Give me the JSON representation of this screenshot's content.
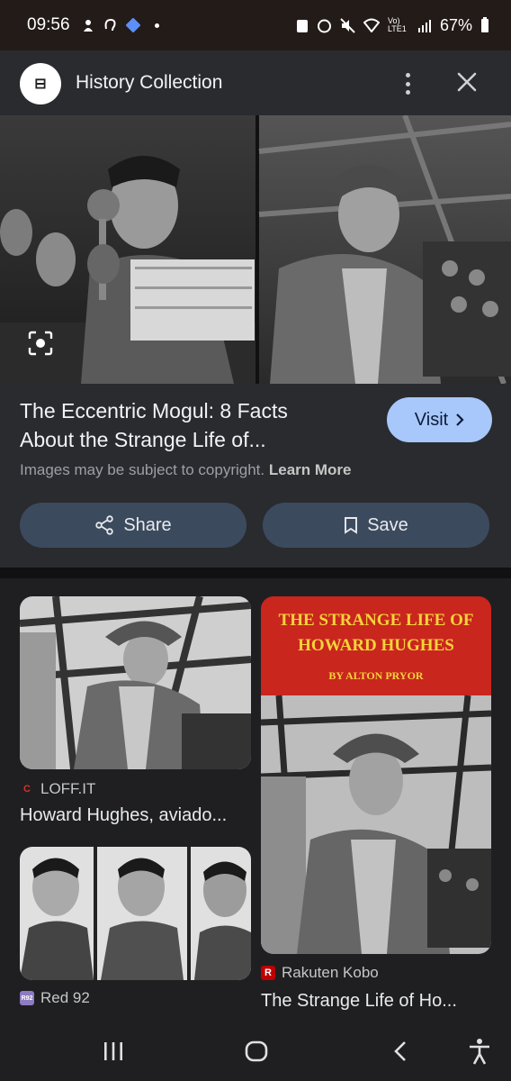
{
  "status_bar": {
    "time": "09:56",
    "network": "Vo) LTE1",
    "battery": "67%"
  },
  "header": {
    "site_name": "History Collection",
    "logo_glyph": "⊟"
  },
  "detail": {
    "title_line1": "The Eccentric Mogul: 8 Facts",
    "title_line2": "About the Strange Life of...",
    "visit_label": "Visit",
    "copyright_text": "Images may be subject to copyright.",
    "learn_more": "Learn More",
    "share_label": "Share",
    "save_label": "Save"
  },
  "results": [
    {
      "source": "LOFF.IT",
      "title": "Howard Hughes, aviado...",
      "favicon_color": "#d93025"
    },
    {
      "source": "Red 92",
      "title": "",
      "favicon_color": "#8e7cc3"
    },
    {
      "source": "Rakuten Kobo",
      "title": "The Strange Life of Ho...",
      "favicon_color": "#bf0000"
    }
  ],
  "book_cover": {
    "line1": "THE STRANGE LIFE OF",
    "line2": "HOWARD HUGHES",
    "author": "BY ALTON PRYOR",
    "bg_color": "#c9261e",
    "text_color": "#f5d33a"
  },
  "nav": {
    "icons": [
      "recent-apps-icon",
      "home-icon",
      "back-icon",
      "accessibility-icon"
    ]
  },
  "colors": {
    "visit_bg": "#a8c7fa",
    "action_bg": "#3c4a5e",
    "panel_bg": "#2a2b2f"
  }
}
